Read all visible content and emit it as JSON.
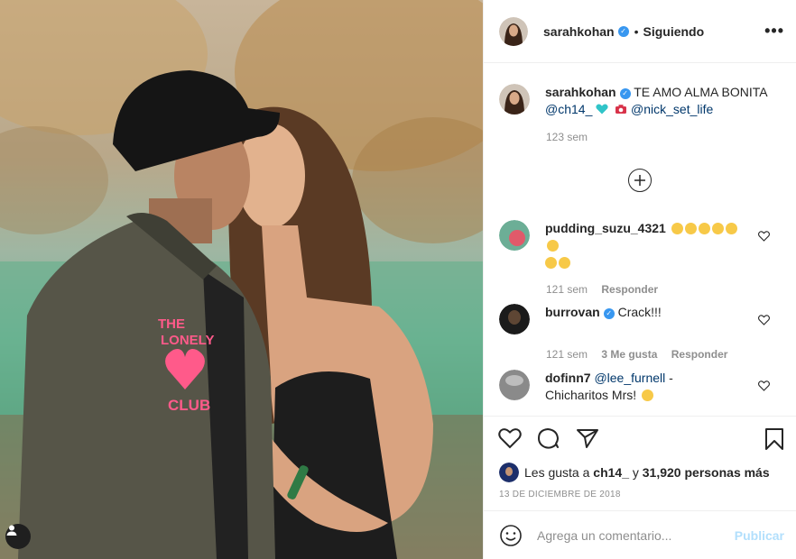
{
  "header": {
    "username": "sarahkohan",
    "separator": "•",
    "follow_label": "Siguiendo",
    "more_label": "•••"
  },
  "caption": {
    "username": "sarahkohan",
    "text": "TE AMO ALMA BONITA",
    "mention1": "@ch14_",
    "mention2": "@nick_set_life",
    "time": "123 sem"
  },
  "photo": {
    "jacket_text_1": "THE",
    "jacket_text_2": "LONELY",
    "jacket_text_3": "CLUB"
  },
  "comments": [
    {
      "username": "pudding_suzu_4321",
      "time": "121 sem",
      "reply": "Responder"
    },
    {
      "username": "burrovan",
      "text": "Crack!!!",
      "time": "121 sem",
      "likes": "3 Me gusta",
      "reply": "Responder"
    },
    {
      "username": "dofinn7",
      "mention": "@lee_furnell",
      "text": "-",
      "text2": "Chicharitos Mrs!"
    }
  ],
  "likes": {
    "prefix": "Les gusta a",
    "user": "ch14_",
    "middle": "y",
    "count": "31,920 personas más"
  },
  "date": "13 DE DICIEMBRE DE 2018",
  "add_comment": {
    "placeholder": "Agrega un comentario...",
    "publish_label": "Publicar"
  },
  "colors": {
    "verified": "#3897f0",
    "mention": "#00376b",
    "publish_disabled": "#b2dffc",
    "jacket_pink": "#ff5a8a"
  }
}
